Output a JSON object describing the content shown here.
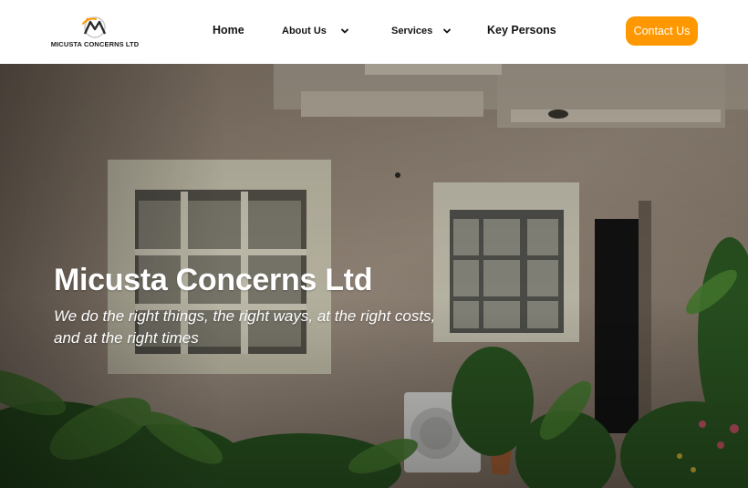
{
  "brand": {
    "name": "MICUSTA CONCERNS LTD",
    "accent_color": "#ff9800",
    "logo_icon": "micusta-logo-icon"
  },
  "nav": {
    "home": "Home",
    "about": "About Us",
    "services": "Services",
    "key_persons": "Key Persons",
    "dropdown_icon": "chevron-down-icon"
  },
  "contact_button": "Contact Us",
  "hero": {
    "title": "Micusta Concerns Ltd",
    "subtitle": "We do the right things, the right ways, at the right costs, and at the right times",
    "background": "house-exterior-photo"
  }
}
